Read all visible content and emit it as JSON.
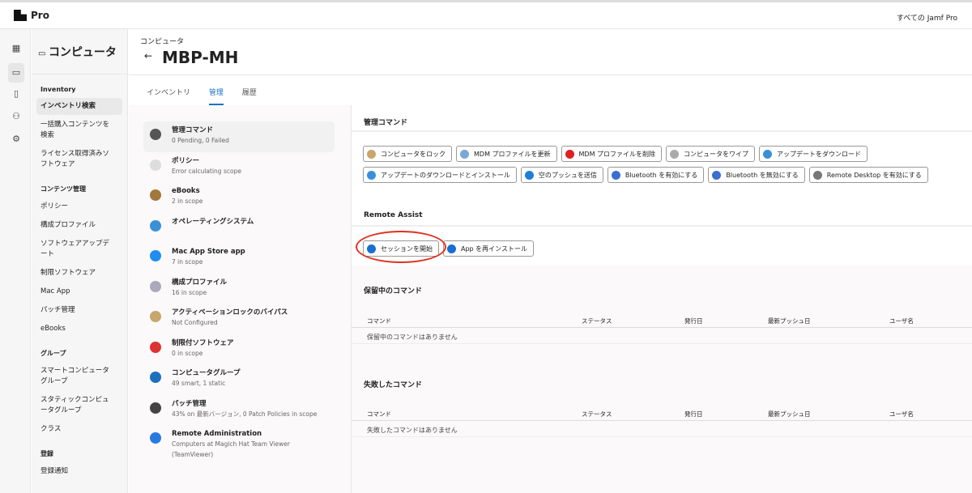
{
  "app": {
    "brand": "Pro",
    "scope": "すべての Jamf Pro"
  },
  "rail": [
    "dashboard-icon",
    "computer-icon",
    "devices-icon",
    "users-icon",
    "settings-icon"
  ],
  "sidebar": {
    "title": "コンピュータ",
    "sections": [
      {
        "label": "Inventory",
        "items": [
          "インベントリ検索",
          "一括購入コンテンツを検索",
          "ライセンス取得済みソフトウェア"
        ]
      },
      {
        "label": "コンテンツ管理",
        "items": [
          "ポリシー",
          "構成プロファイル",
          "ソフトウェアアップデート",
          "制限ソフトウェア",
          "Mac App",
          "パッチ管理",
          "eBooks"
        ]
      },
      {
        "label": "グループ",
        "items": [
          "スマートコンピュータグループ",
          "スタティックコンピュータグループ",
          "クラス"
        ]
      },
      {
        "label": "登録",
        "items": [
          "登録通知"
        ]
      }
    ]
  },
  "header": {
    "breadcrumb": "コンピュータ",
    "title": "MBP-MH",
    "back": "←"
  },
  "tabs": [
    "インベントリ",
    "管理",
    "履歴"
  ],
  "list": [
    {
      "title": "管理コマンド",
      "sub": "0 Pending, 0 Failed",
      "color": "#555"
    },
    {
      "title": "ポリシー",
      "sub": "Error calculating scope",
      "color": "#ddd"
    },
    {
      "title": "eBooks",
      "sub": "2 in scope",
      "color": "#a0783c"
    },
    {
      "title": "オペレーティングシステム",
      "sub": "",
      "color": "#3b8fd9"
    },
    {
      "title": "Mac App Store app",
      "sub": "7 in scope",
      "color": "#1e8ef0"
    },
    {
      "title": "構成プロファイル",
      "sub": "16 in scope",
      "color": "#aab"
    },
    {
      "title": "アクティベーションロックのバイパス",
      "sub": "Not Configured",
      "color": "#c9a66b"
    },
    {
      "title": "制限付ソフトウェア",
      "sub": "0 in scope",
      "color": "#d33"
    },
    {
      "title": "コンピュータグループ",
      "sub": "49 smart, 1 static",
      "color": "#1f6fbf"
    },
    {
      "title": "パッチ管理",
      "sub": "43% on 最新バージョン, 0 Patch Policies in scope",
      "color": "#444"
    },
    {
      "title": "Remote Administration",
      "sub": "Computers at Magich Hat Team Viewer (TeamViewer)",
      "color": "#2a7be0"
    }
  ],
  "commands": {
    "heading": "管理コマンド",
    "buttons": [
      {
        "label": "コンピュータをロック",
        "color": "#c9a66b"
      },
      {
        "label": "MDM プロファイルを更新",
        "color": "#7aa7d6"
      },
      {
        "label": "MDM プロファイルを削除",
        "color": "#d22"
      },
      {
        "label": "コンピュータをワイプ",
        "color": "#aaa"
      },
      {
        "label": "アップデートをダウンロード",
        "color": "#3b8fd9"
      },
      {
        "label": "アップデートのダウンロードとインストール",
        "color": "#3b8fd9"
      },
      {
        "label": "空のプッシュを送信",
        "color": "#1e7fd8"
      },
      {
        "label": "Bluetooth を有効にする",
        "color": "#3a6ed0"
      },
      {
        "label": "Bluetooth を無効にする",
        "color": "#3a6ed0"
      },
      {
        "label": "Remote Desktop を有効にする",
        "color": "#777"
      }
    ]
  },
  "remote": {
    "heading": "Remote Assist",
    "buttons": [
      {
        "label": "セッションを開始",
        "color": "#1a6fd0"
      },
      {
        "label": "App を再インストール",
        "color": "#1a6fd0"
      }
    ]
  },
  "pending": {
    "heading": "保留中のコマンド",
    "columns": [
      "コマンド",
      "ステータス",
      "発行日",
      "最新プッシュ日",
      "ユーザ名"
    ],
    "empty": "保留中のコマンドはありません"
  },
  "failed": {
    "heading": "失敗したコマンド",
    "columns": [
      "コマンド",
      "ステータス",
      "発行日",
      "最新プッシュ日",
      "ユーザ名"
    ],
    "empty": "失敗したコマンドはありません"
  }
}
